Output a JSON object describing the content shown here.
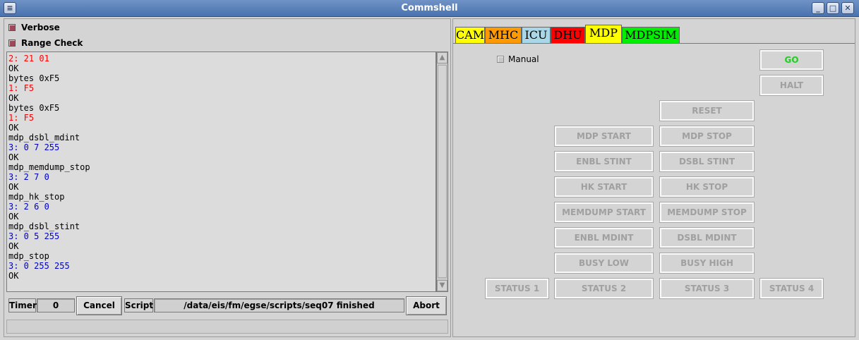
{
  "window": {
    "title": "Commshell",
    "controls": {
      "minimize": "_",
      "maximize": "□",
      "close": "✕"
    }
  },
  "left": {
    "verbose_label": "Verbose",
    "range_check_label": "Range Check",
    "console_lines": [
      {
        "text": "2: 21 01",
        "color": "#ff0000"
      },
      {
        "text": "OK",
        "color": "#000000"
      },
      {
        "text": "bytes 0xF5",
        "color": "#000000"
      },
      {
        "text": "1: F5",
        "color": "#ff0000"
      },
      {
        "text": "OK",
        "color": "#000000"
      },
      {
        "text": "bytes 0xF5",
        "color": "#000000"
      },
      {
        "text": "1: F5",
        "color": "#ff0000"
      },
      {
        "text": "OK",
        "color": "#000000"
      },
      {
        "text": "mdp_dsbl_mdint",
        "color": "#000000"
      },
      {
        "text": "3: 0 7 255",
        "color": "#0000cc"
      },
      {
        "text": "OK",
        "color": "#000000"
      },
      {
        "text": "mdp_memdump_stop",
        "color": "#000000"
      },
      {
        "text": "3: 2 7 0",
        "color": "#0000cc"
      },
      {
        "text": "OK",
        "color": "#000000"
      },
      {
        "text": "mdp_hk_stop",
        "color": "#000000"
      },
      {
        "text": "3: 2 6 0",
        "color": "#0000cc"
      },
      {
        "text": "OK",
        "color": "#000000"
      },
      {
        "text": "mdp_dsbl_stint",
        "color": "#000000"
      },
      {
        "text": "3: 0 5 255",
        "color": "#0000cc"
      },
      {
        "text": "OK",
        "color": "#000000"
      },
      {
        "text": "mdp_stop",
        "color": "#000000"
      },
      {
        "text": "3: 0 255 255",
        "color": "#0000cc"
      },
      {
        "text": "OK",
        "color": "#000000"
      }
    ],
    "statusbar": {
      "timer_label": "Timer",
      "timer_value": "0",
      "cancel_label": "Cancel",
      "script_label": "Script",
      "script_value": "/data/eis/fm/egse/scripts/seq07 finished",
      "abort_label": "Abort"
    }
  },
  "right": {
    "tabs": [
      {
        "label": "CAM",
        "color": "#ffff00"
      },
      {
        "label": "MHC",
        "color": "#ff9900"
      },
      {
        "label": "ICU",
        "color": "#a8d8e8"
      },
      {
        "label": "DHU",
        "color": "#ff0000"
      },
      {
        "label": "MDP",
        "color": "#ffff00"
      },
      {
        "label": "MDPSIM",
        "color": "#00ee00"
      }
    ],
    "active_tab": "MDP",
    "manual_label": "Manual",
    "buttons": {
      "go": "GO",
      "halt": "HALT",
      "reset": "RESET",
      "mdp_start": "MDP START",
      "mdp_stop": "MDP STOP",
      "enbl_stint": "ENBL STINT",
      "dsbl_stint": "DSBL STINT",
      "hk_start": "HK START",
      "hk_stop": "HK STOP",
      "memdump_start": "MEMDUMP START",
      "memdump_stop": "MEMDUMP STOP",
      "enbl_mdint": "ENBL MDINT",
      "dsbl_mdint": "DSBL MDINT",
      "busy_low": "BUSY LOW",
      "busy_high": "BUSY HIGH",
      "status_1": "STATUS 1",
      "status_2": "STATUS 2",
      "status_3": "STATUS 3",
      "status_4": "STATUS 4"
    }
  }
}
